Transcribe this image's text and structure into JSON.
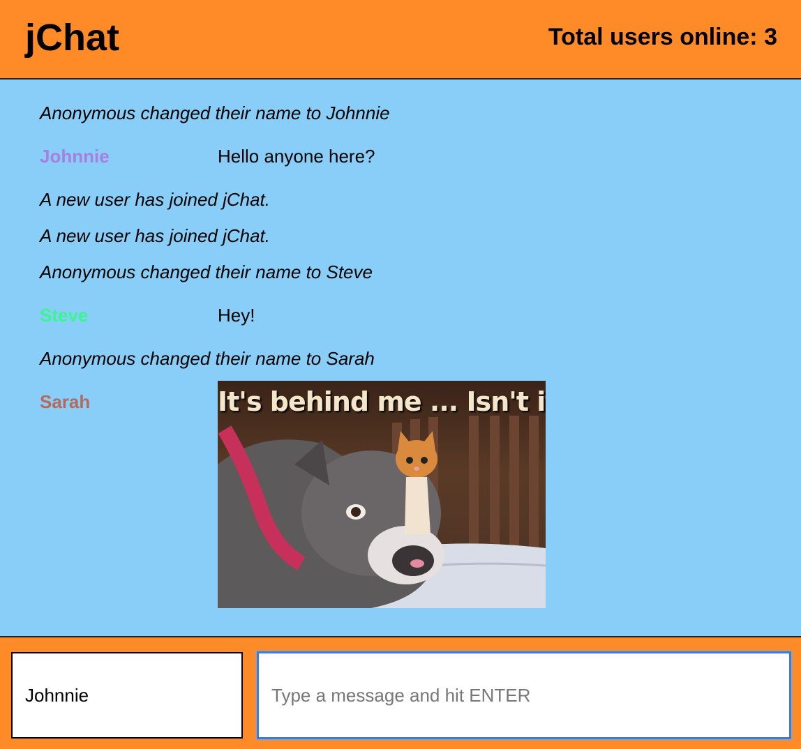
{
  "header": {
    "title": "jChat",
    "online_label": "Total users online: 3"
  },
  "colors": {
    "header_bg": "#FF8B28",
    "chat_bg": "#89CEF8",
    "input_focus_border": "#3D7BD6",
    "user_johnnie": "#A77FE0",
    "user_steve": "#3BF590",
    "user_sarah": "#B56A5C"
  },
  "messages": [
    {
      "type": "system",
      "text": "Anonymous changed their name to Johnnie"
    },
    {
      "type": "chat",
      "user": "Johnnie",
      "text": "Hello anyone here?"
    },
    {
      "type": "system",
      "text": "A new user has joined jChat."
    },
    {
      "type": "system",
      "text": "A new user has joined jChat."
    },
    {
      "type": "system",
      "text": "Anonymous changed their name to Steve"
    },
    {
      "type": "chat",
      "user": "Steve",
      "text": "Hey!"
    },
    {
      "type": "system",
      "text": "Anonymous changed their name to Sarah"
    },
    {
      "type": "image",
      "user": "Sarah",
      "image_caption": "It's behind me ... Isn't it?"
    }
  ],
  "footer": {
    "name_value": "Johnnie",
    "message_placeholder": "Type a message and hit ENTER",
    "message_value": ""
  }
}
